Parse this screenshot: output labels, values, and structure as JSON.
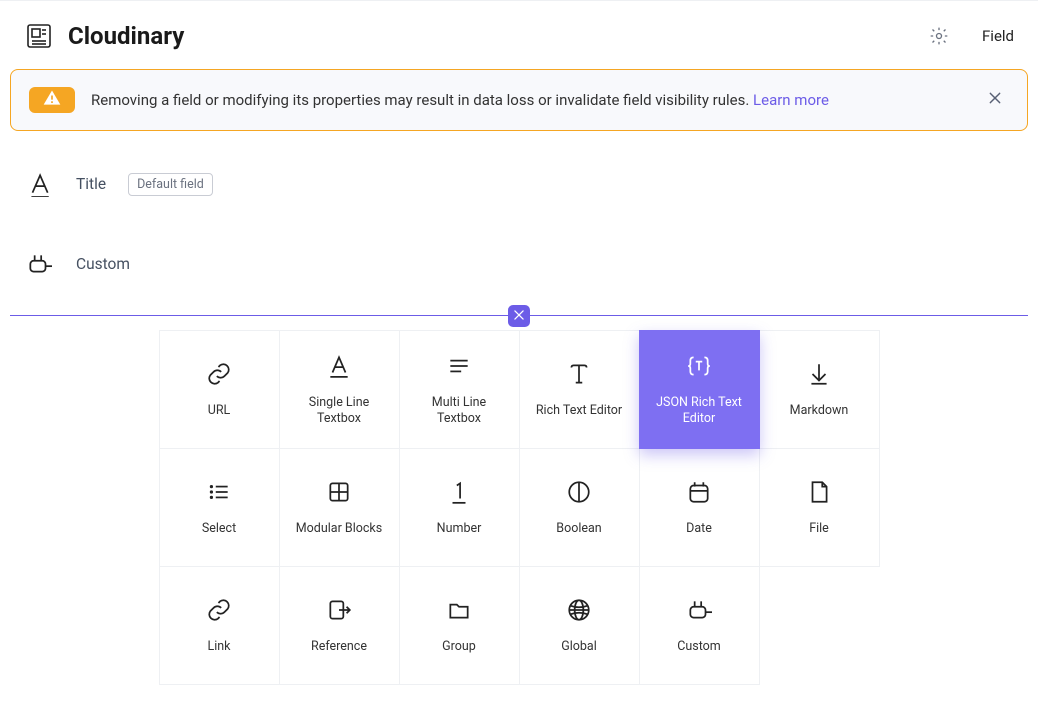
{
  "header": {
    "title": "Cloudinary",
    "nav_link": "Field"
  },
  "alert": {
    "text": "Removing a field or modifying its properties may result in data loss or invalidate field visibility rules. ",
    "link_text": "Learn more"
  },
  "fields": [
    {
      "id": "title",
      "label": "Title",
      "icon": "text-icon",
      "badge": "Default field"
    },
    {
      "id": "custom",
      "label": "Custom",
      "icon": "plugin-icon",
      "badge": null
    }
  ],
  "picker": {
    "selected": "json_rte",
    "options": [
      {
        "id": "url",
        "label": "URL",
        "icon": "link-icon"
      },
      {
        "id": "slt",
        "label": "Single Line Textbox",
        "icon": "text-underline-icon"
      },
      {
        "id": "mlt",
        "label": "Multi Line Textbox",
        "icon": "lines-icon"
      },
      {
        "id": "rte",
        "label": "Rich Text Editor",
        "icon": "serif-t-icon"
      },
      {
        "id": "json_rte",
        "label": "JSON Rich Text Editor",
        "icon": "braces-t-icon"
      },
      {
        "id": "markdown",
        "label": "Markdown",
        "icon": "arrow-down-icon"
      },
      {
        "id": "select",
        "label": "Select",
        "icon": "list-icon"
      },
      {
        "id": "modular",
        "label": "Modular Blocks",
        "icon": "grid4-icon"
      },
      {
        "id": "number",
        "label": "Number",
        "icon": "one-underline-icon"
      },
      {
        "id": "boolean",
        "label": "Boolean",
        "icon": "half-circle-icon"
      },
      {
        "id": "date",
        "label": "Date",
        "icon": "calendar-icon"
      },
      {
        "id": "file",
        "label": "File",
        "icon": "file-icon"
      },
      {
        "id": "link",
        "label": "Link",
        "icon": "link-icon"
      },
      {
        "id": "reference",
        "label": "Reference",
        "icon": "exit-icon"
      },
      {
        "id": "group",
        "label": "Group",
        "icon": "folder-icon"
      },
      {
        "id": "global",
        "label": "Global",
        "icon": "globe-icon"
      },
      {
        "id": "custom",
        "label": "Custom",
        "icon": "plugin-icon"
      }
    ]
  }
}
